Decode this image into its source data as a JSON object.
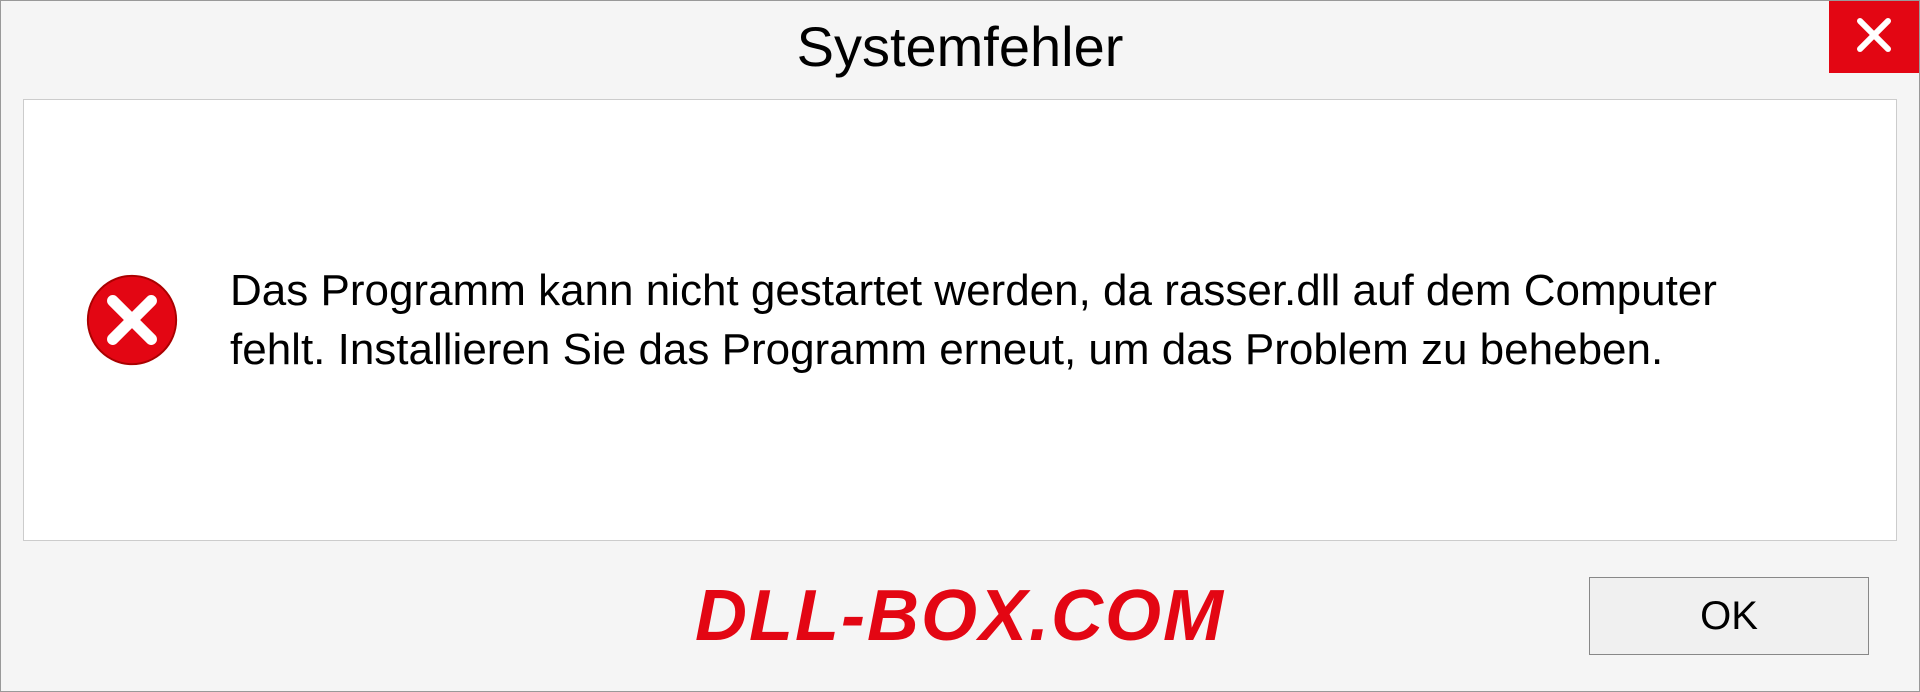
{
  "dialog": {
    "title": "Systemfehler",
    "message": "Das Programm kann nicht gestartet werden, da rasser.dll auf dem Computer fehlt. Installieren Sie das Programm erneut, um das Problem zu beheben.",
    "ok_label": "OK"
  },
  "watermark": "DLL-BOX.COM"
}
